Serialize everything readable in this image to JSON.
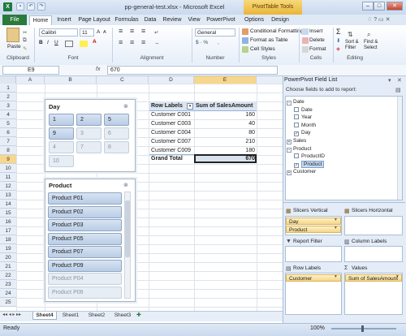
{
  "window": {
    "title": "pp-general-test.xlsx - Microsoft Excel",
    "contextual_tab": "PivotTable Tools",
    "app_icon": "X"
  },
  "tabs": [
    "File",
    "Home",
    "Insert",
    "Page Layout",
    "Formulas",
    "Data",
    "Review",
    "View",
    "PowerPivot",
    "Options",
    "Design"
  ],
  "ribbon": {
    "paste_label": "Paste",
    "font_name": "Calibri",
    "font_size": "11",
    "number_format": "General",
    "styles": [
      "Conditional Formatting",
      "Format as Table",
      "Cell Styles"
    ],
    "cells": [
      "Insert",
      "Delete",
      "Format"
    ],
    "editing": {
      "sum": "Σ",
      "sort_filter": "Sort & Filter",
      "find_select": "Find & Select"
    },
    "groups": [
      "Clipboard",
      "Font",
      "Alignment",
      "Number",
      "Styles",
      "Cells",
      "Editing"
    ]
  },
  "formula_bar": {
    "name_box": "E9",
    "fx": "fx",
    "value": "670"
  },
  "columns": [
    "A",
    "B",
    "C",
    "D",
    "E"
  ],
  "rows": [
    "1",
    "2",
    "3",
    "4",
    "5",
    "6",
    "7",
    "8",
    "9",
    "10",
    "11",
    "12",
    "13",
    "14",
    "15",
    "16",
    "17",
    "18",
    "19",
    "20",
    "21",
    "22",
    "23",
    "24",
    "25"
  ],
  "selected_cell": {
    "column": "E",
    "row": "9"
  },
  "pivot": {
    "row_labels": "Row Labels",
    "value_header": "Sum of SalesAmount",
    "rows": [
      {
        "label": "Customer C001",
        "value": "160"
      },
      {
        "label": "Customer C003",
        "value": "40"
      },
      {
        "label": "Customer C004",
        "value": "80"
      },
      {
        "label": "Customer C007",
        "value": "210"
      },
      {
        "label": "Customer C009",
        "value": "180"
      }
    ],
    "total_label": "Grand Total",
    "total_value": "670"
  },
  "slicer_day": {
    "title": "Day",
    "items": [
      {
        "label": "1",
        "state": "selected"
      },
      {
        "label": "2",
        "state": "selected"
      },
      {
        "label": "5",
        "state": "selected"
      },
      {
        "label": "9",
        "state": "selected"
      },
      {
        "label": "3",
        "state": "dim"
      },
      {
        "label": "6",
        "state": "dim"
      },
      {
        "label": "4",
        "state": "dim"
      },
      {
        "label": "7",
        "state": "dim"
      },
      {
        "label": "8",
        "state": "dim"
      },
      {
        "label": "10",
        "state": "dim"
      }
    ]
  },
  "slicer_product": {
    "title": "Product",
    "items": [
      {
        "label": "Product P01",
        "state": "selected"
      },
      {
        "label": "Product P02",
        "state": "selected"
      },
      {
        "label": "Product P03",
        "state": "selected"
      },
      {
        "label": "Product P05",
        "state": "selected"
      },
      {
        "label": "Product P07",
        "state": "selected"
      },
      {
        "label": "Product P09",
        "state": "selected"
      },
      {
        "label": "Product P04",
        "state": "dim"
      },
      {
        "label": "Product P06",
        "state": "dim"
      }
    ]
  },
  "sheets": [
    "Sheet4",
    "Sheet1",
    "Sheet2",
    "Sheet3"
  ],
  "status": {
    "left": "Ready",
    "zoom": "100%"
  },
  "field_list": {
    "title": "PowerPivot Field List",
    "choose": "Choose fields to add to report:",
    "tree": [
      {
        "label": "Date",
        "level": 0,
        "kind": "expanded"
      },
      {
        "label": "Date",
        "level": 1,
        "kind": "unchecked"
      },
      {
        "label": "Year",
        "level": 1,
        "kind": "unchecked"
      },
      {
        "label": "Month",
        "level": 1,
        "kind": "unchecked"
      },
      {
        "label": "Day",
        "level": 1,
        "kind": "checked"
      },
      {
        "label": "Sales",
        "level": 0,
        "kind": "collapsed"
      },
      {
        "label": "Product",
        "level": 0,
        "kind": "expanded"
      },
      {
        "label": "ProductID",
        "level": 1,
        "kind": "unchecked"
      },
      {
        "label": "Product",
        "level": 1,
        "kind": "highlighted"
      },
      {
        "label": "Customer",
        "level": 0,
        "kind": "collapsed"
      }
    ],
    "slicers_vertical": {
      "label": "Slicers Vertical",
      "items": [
        "Day",
        "Product"
      ]
    },
    "slicers_horizontal": {
      "label": "Slicers Horizontal"
    },
    "report_filter": {
      "label": "Report Filter"
    },
    "column_labels": {
      "label": "Column Labels"
    },
    "row_labels": {
      "label": "Row Labels",
      "items": [
        "Customer"
      ]
    },
    "values": {
      "label": "Values",
      "items": [
        "Sum of SalesAmount"
      ]
    }
  }
}
